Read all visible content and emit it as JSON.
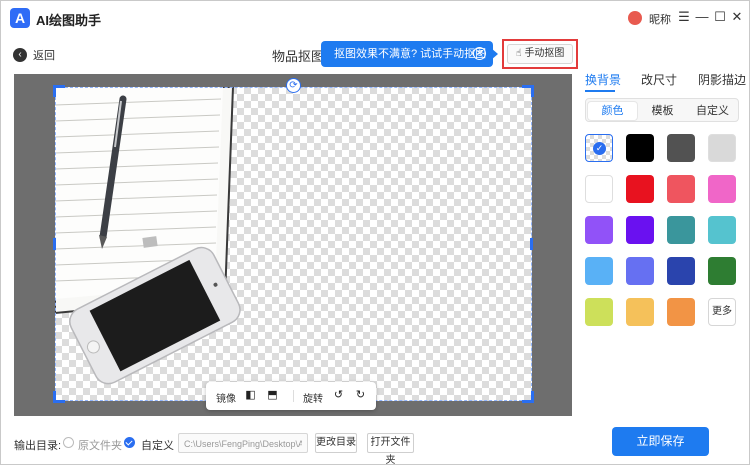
{
  "app": {
    "logo_text": "A",
    "title": "AI绘图助手"
  },
  "user": {
    "nickname": "昵称"
  },
  "window_controls": {
    "menu": "☰",
    "minimize": "—",
    "maximize": "☐",
    "close": "✕"
  },
  "toolbar": {
    "back_label": "返回",
    "mode_title": "物品抠图",
    "tip_text": "抠图效果不满意? 试试手动抠图吧",
    "tip_close": "✕",
    "manual_label": "手动抠图"
  },
  "canvas_tools": {
    "mirror_label": "镜像",
    "rotate_label": "旋转"
  },
  "panel": {
    "tabs": [
      {
        "label": "换背景",
        "active": true
      },
      {
        "label": "改尺寸",
        "active": false
      },
      {
        "label": "阴影描边",
        "active": false
      }
    ],
    "segments": [
      {
        "label": "颜色",
        "active": true
      },
      {
        "label": "模板",
        "active": false
      },
      {
        "label": "自定义",
        "active": false
      }
    ],
    "swatches": [
      "transparent",
      "#000000",
      "#525252",
      "#d9d9d9",
      "#ffffff",
      "#e8121f",
      "#ef555f",
      "#f066c8",
      "#9152f8",
      "#6a11f0",
      "#3a969c",
      "#55c3cf",
      "#59b1f6",
      "#6670f2",
      "#2a44ad",
      "#2e7d32",
      "#cde05a",
      "#f5c15a",
      "#f29445"
    ],
    "more_label": "更多"
  },
  "footer": {
    "output_label": "输出目录:",
    "option_original": "原文件夹",
    "option_custom": "自定义",
    "path_value": "C:\\Users\\FengPing\\Desktop\\AI绘图",
    "change_dir_label": "更改目录",
    "open_folder_label": "打开文件夹",
    "save_label": "立即保存"
  },
  "colors": {
    "accent": "#1e7bf0",
    "highlight_border": "#e33b3b"
  }
}
